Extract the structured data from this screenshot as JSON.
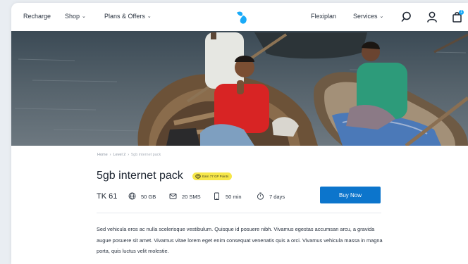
{
  "header": {
    "left_nav": [
      {
        "label": "Recharge",
        "has_dropdown": false
      },
      {
        "label": "Shop",
        "has_dropdown": true
      },
      {
        "label": "Plans & Offers",
        "has_dropdown": true
      }
    ],
    "right_nav": [
      {
        "label": "Flexiplan",
        "has_dropdown": false
      },
      {
        "label": "Services",
        "has_dropdown": true
      }
    ],
    "icons": [
      "search-icon",
      "user-icon",
      "cart-icon"
    ],
    "cart_count": "1",
    "logo_icon": "telenor-logo-icon"
  },
  "hero": {
    "image": "two men in wooden rowboats on a river"
  },
  "breadcrumb": [
    "Home",
    "Level 2",
    "5gb internet pack"
  ],
  "product": {
    "title": "5gb internet pack",
    "points_badge": "Earn 77 GP Points",
    "price": "TK 61",
    "features": [
      {
        "icon": "globe-icon",
        "value": "50 GB"
      },
      {
        "icon": "mail-icon",
        "value": "20 SMS"
      },
      {
        "icon": "phone-icon",
        "value": "50 min"
      },
      {
        "icon": "stopwatch-icon",
        "value": "7 days"
      }
    ],
    "buy_label": "Buy Now",
    "description": "Sed vehicula eros ac nulla scelerisque vestibulum. Quisque id posuere nibh. Vivamus egestas accumsan arcu, a gravida augue posuere sit amet. Vivamus vitae lorem eget enim consequat venenatis quis a orci. Vivamus vehicula massa in magna porta, quis luctus velit molestie."
  },
  "colors": {
    "accent": "#0c75cc",
    "logo": "#19aaf8",
    "badge": "#f7e74a"
  }
}
